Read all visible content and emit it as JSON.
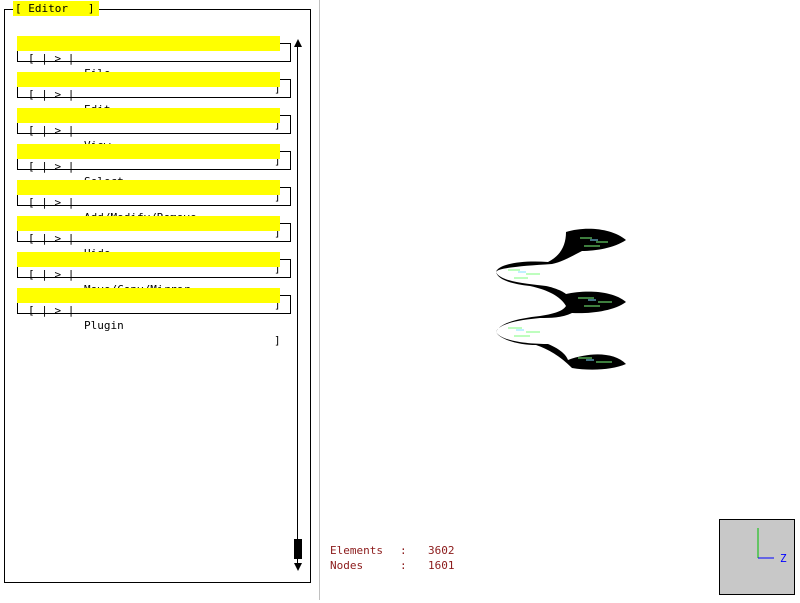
{
  "panel": {
    "title": "[ Editor   ]",
    "items": [
      {
        "prefix": "[ | > |",
        "label": "File",
        "suffix": "]"
      },
      {
        "prefix": "[ | > |",
        "label": "Edit",
        "suffix": "]"
      },
      {
        "prefix": "[ | > |",
        "label": "View",
        "suffix": "]"
      },
      {
        "prefix": "[ | > |",
        "label": "Select",
        "suffix": "]"
      },
      {
        "prefix": "[ | > |",
        "label": "Add/Modify/Remove",
        "suffix": "]"
      },
      {
        "prefix": "[ | > |",
        "label": "Hide",
        "suffix": "]"
      },
      {
        "prefix": "[ | > |",
        "label": "Move/Copy/Mirror",
        "suffix": "]"
      },
      {
        "prefix": "[ | > |",
        "label": "Plugin",
        "suffix": "]"
      }
    ]
  },
  "stats": {
    "elements_label": "Elements",
    "elements_value": "3602",
    "nodes_label": "Nodes",
    "nodes_value": "1601",
    "separator": ":"
  },
  "axis": {
    "y_label": "",
    "z_label": "Z",
    "colors": {
      "y": "#00c000",
      "z": "#0000ff"
    }
  },
  "colors": {
    "menu_bar": "#ffff00",
    "stats_text": "#8b1a1a",
    "axis_background": "#c8c8c8",
    "mesh_fill": "#000000",
    "mesh_accent_green": "#7cfc7c",
    "mesh_accent_cyan": "#7fe0ff"
  }
}
